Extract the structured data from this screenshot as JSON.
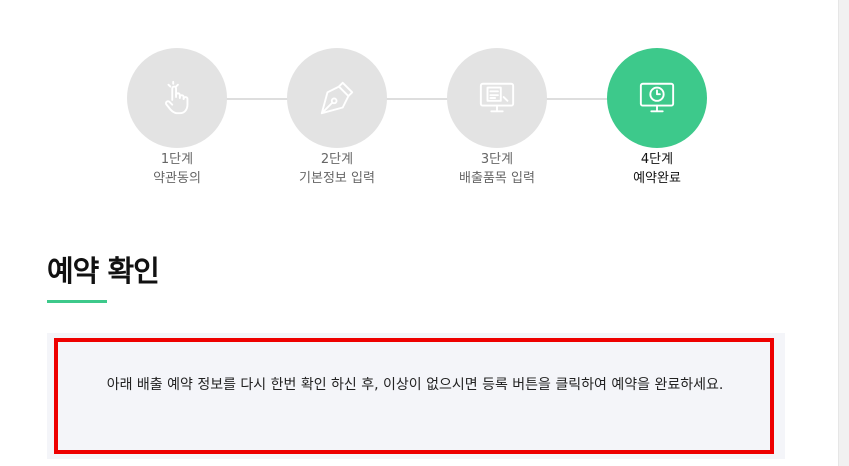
{
  "steps": [
    {
      "number": "1단계",
      "name": "약관동의",
      "icon": "touch-hand-icon",
      "active": false
    },
    {
      "number": "2단계",
      "name": "기본정보 입력",
      "icon": "pen-nib-icon",
      "active": false
    },
    {
      "number": "3단계",
      "name": "배출품목 입력",
      "icon": "monitor-document-icon",
      "active": false
    },
    {
      "number": "4단계",
      "name": "예약완료",
      "icon": "monitor-clock-icon",
      "active": true
    }
  ],
  "section": {
    "title": "예약 확인"
  },
  "notice": {
    "text": "아래 배출 예약 정보를 다시 한번 확인 하신 후, 이상이 없으시면 등록 버튼을 클릭하여 예약을 완료하세요."
  },
  "colors": {
    "accent": "#3dc98b",
    "inactive_circle": "#e3e3e3",
    "highlight_border": "#ee0000",
    "notice_bg": "#f4f5f9"
  }
}
